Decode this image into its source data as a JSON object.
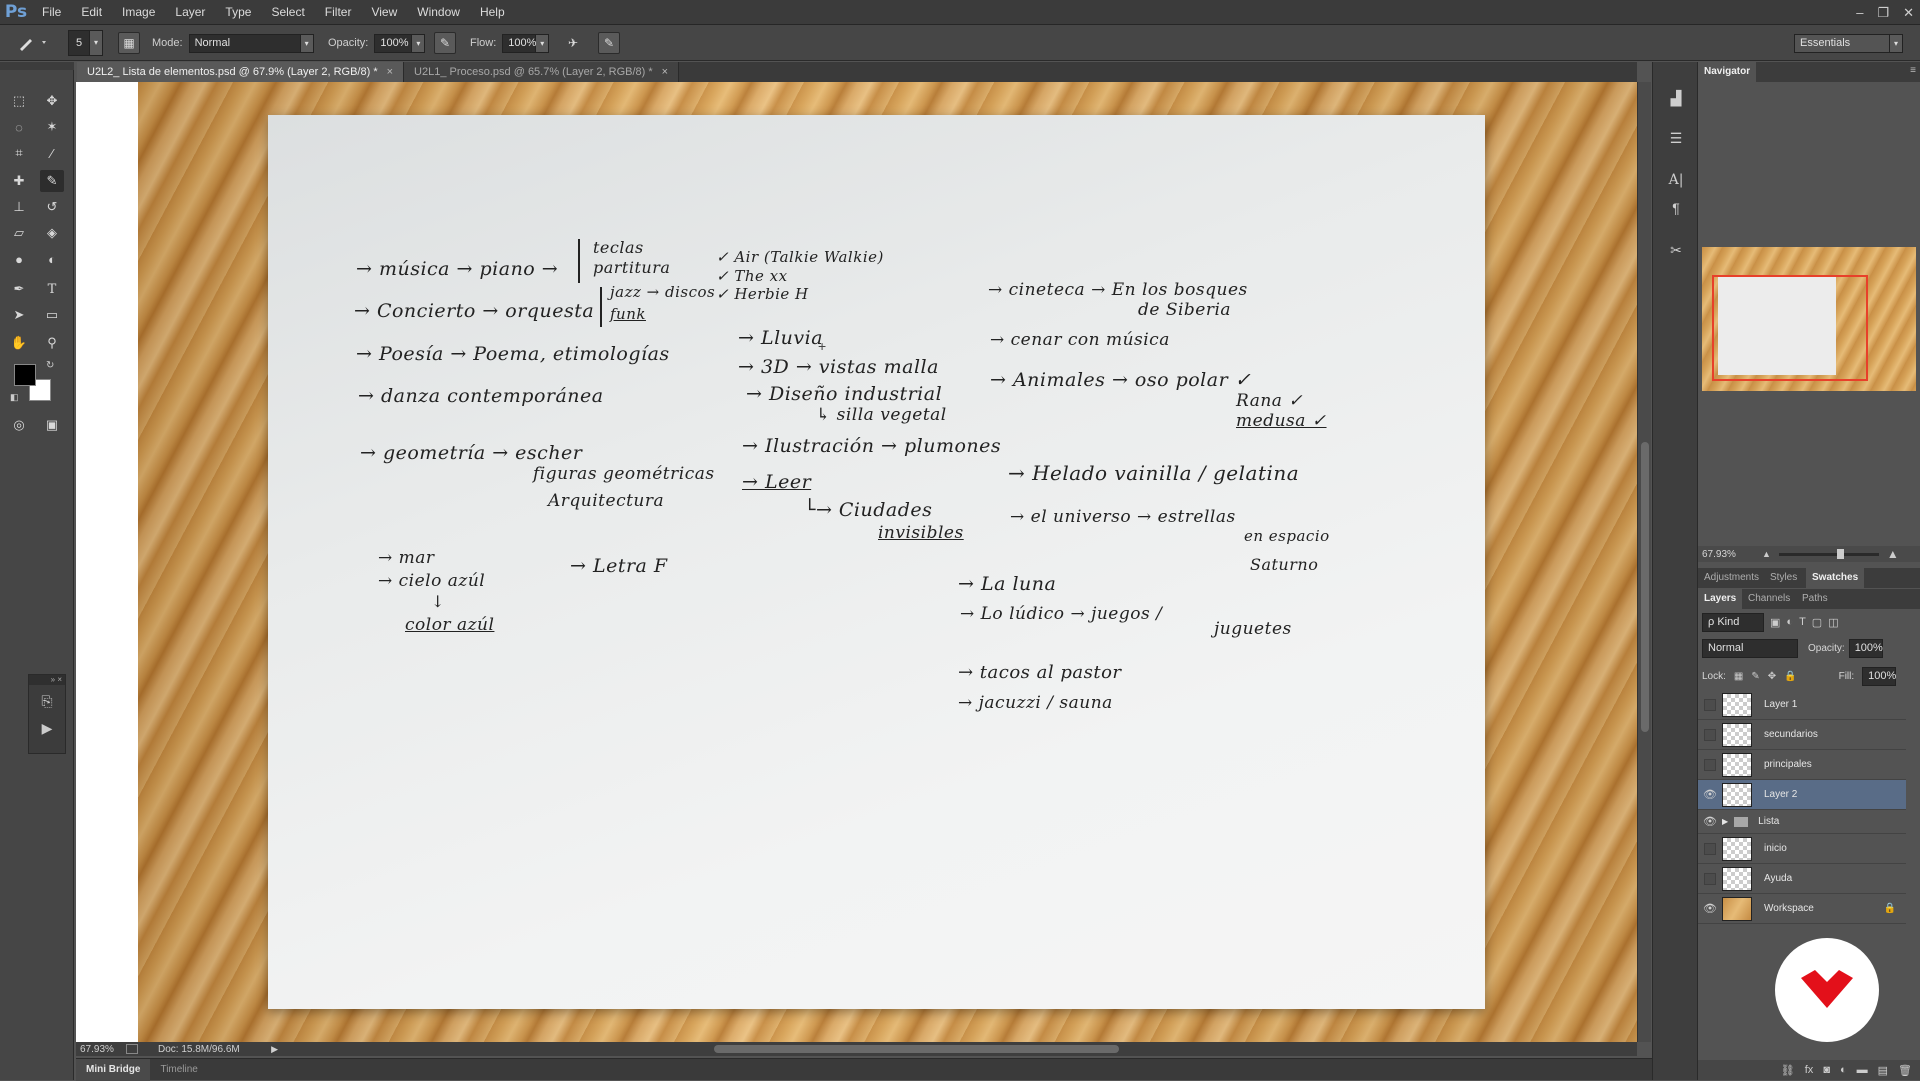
{
  "app": {
    "logo": "Ps"
  },
  "menu": [
    "File",
    "Edit",
    "Image",
    "Layer",
    "Type",
    "Select",
    "Filter",
    "View",
    "Window",
    "Help"
  ],
  "window_controls": {
    "minimize": "–",
    "restore": "❐",
    "close": "✕"
  },
  "options": {
    "brush_size": "5",
    "mode_label": "Mode:",
    "mode_value": "Normal",
    "opacity_label": "Opacity:",
    "opacity_value": "100%",
    "flow_label": "Flow:",
    "flow_value": "100%",
    "workspace": "Essentials"
  },
  "tabs": [
    {
      "title": "U2L2_ Lista de elementos.psd @ 67.9% (Layer 2, RGB/8) *",
      "close": "×"
    },
    {
      "title": "U2L1_ Proceso.psd @ 65.7% (Layer 2, RGB/8) *",
      "close": "×"
    }
  ],
  "tools": [
    "marquee-icon",
    "move-icon",
    "lasso-icon",
    "magic-wand-icon",
    "crop-icon",
    "eyedropper-icon",
    "healing-icon",
    "brush-icon",
    "stamp-icon",
    "history-brush-icon",
    "eraser-icon",
    "paint-bucket-icon",
    "blur-icon",
    "dodge-icon",
    "pen-icon",
    "type-icon",
    "path-select-icon",
    "rectangle-icon",
    "hand-icon",
    "zoom-icon"
  ],
  "notes": {
    "c1": [
      "→ música → piano →",
      "→ Concierto → orquesta",
      "→ Poesía → Poema, etimologías",
      "→ danza contemporánea",
      "→ geometría → escher",
      "figuras geométricas",
      "Arquitectura",
      "→ mar",
      "→ cielo azúl",
      "↓",
      "color azúl",
      "→ Letra F"
    ],
    "piano_sub": [
      "teclas",
      "partitura"
    ],
    "orq_sub": [
      "jazz → discos",
      "funk"
    ],
    "discos": [
      "✓ Air (Talkie Walkie)",
      "✓ The xx",
      "✓ Herbie H"
    ],
    "c2": [
      "→ Lluvia",
      "→ 3D → vistas malla",
      "→ Diseño industrial",
      "↳ silla vegetal",
      "→ Ilustración → plumones",
      "→ Leer",
      "└→ Ciudades",
      "invisibles"
    ],
    "c3": [
      "→ cineteca → En los bosques",
      "de Siberia",
      "→ cenar con música",
      "→ Animales → oso polar ✓",
      "Rana ✓",
      "medusa ✓",
      "→ Helado vainilla / gelatina",
      "→ el universo → estrellas",
      "en espacio",
      "Saturno",
      "→ La luna",
      "→ Lo lúdico → juegos /",
      "juguetes",
      "→ tacos al pastor",
      "→ jacuzzi / sauna"
    ]
  },
  "status": {
    "zoom": "67.93%",
    "doc": "Doc: 15.8M/96.6M"
  },
  "bottom_tabs": [
    "Mini Bridge",
    "Timeline"
  ],
  "navigator": {
    "title": "Navigator",
    "zoom": "67.93%"
  },
  "panel_tabs_top": [
    "Adjustments",
    "Styles",
    "Swatches"
  ],
  "panel_tabs": [
    "Layers",
    "Channels",
    "Paths"
  ],
  "layers_panel": {
    "kind": "ρ Kind",
    "blend": "Normal",
    "opacity_label": "Opacity:",
    "opacity": "100%",
    "lock_label": "Lock:",
    "fill_label": "Fill:",
    "fill": "100%"
  },
  "layers": [
    {
      "name": "Layer 1",
      "visible": false
    },
    {
      "name": "secundarios",
      "visible": false
    },
    {
      "name": "principales",
      "visible": false
    },
    {
      "name": "Layer 2",
      "visible": true,
      "selected": true
    },
    {
      "name": "Lista",
      "visible": true,
      "group": true
    },
    {
      "name": "inicio",
      "visible": false
    },
    {
      "name": "Ayuda",
      "visible": false
    },
    {
      "name": "Workspace",
      "visible": true,
      "locked": true
    }
  ],
  "colors": {
    "accent": "#596c87",
    "brand": "#e3101a",
    "nav_frame": "#e8402a"
  }
}
